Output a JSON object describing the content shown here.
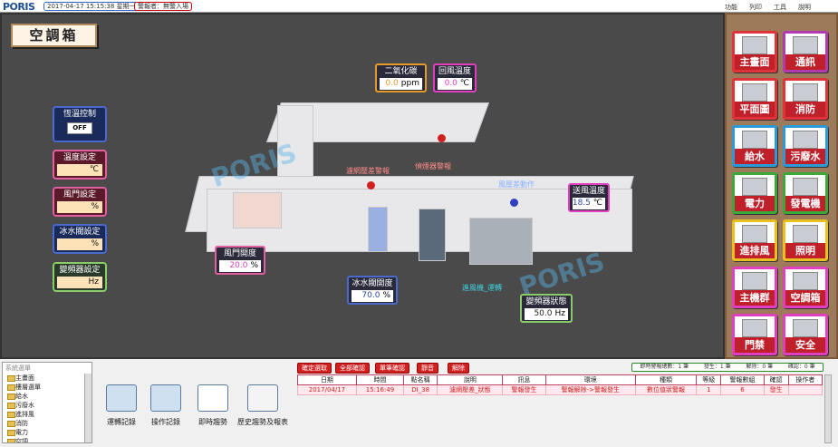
{
  "topbar": {
    "logo": "PORIS",
    "datetime": "2017-04-17 15:15:38 星期一",
    "alarm": "警報者：無警入場",
    "menu": [
      "功能",
      "列印",
      "工具",
      "說明"
    ]
  },
  "page_title": "空調箱",
  "left_controls": [
    {
      "label": "恆溫控制",
      "toggle": "OFF"
    },
    {
      "label": "溫度設定",
      "unit": "℃"
    },
    {
      "label": "風門設定",
      "unit": "%"
    },
    {
      "label": "冰水閥設定",
      "unit": "%"
    },
    {
      "label": "變頻器設定",
      "unit": "Hz"
    }
  ],
  "readouts": {
    "co2": {
      "label": "二氧化碳",
      "value": "0.0",
      "unit": "ppm"
    },
    "return_temp": {
      "label": "回風溫度",
      "value": "0.0",
      "unit": "℃"
    },
    "supply_temp": {
      "label": "送風溫度",
      "value": "18.5",
      "unit": "℃"
    },
    "damper_open": {
      "label": "風門開度",
      "value": "20.0",
      "unit": "%"
    },
    "chw_valve": {
      "label": "冰水閥開度",
      "value": "70.0",
      "unit": "%"
    },
    "vfd_status": {
      "label": "變頻器狀態",
      "value": "50.0",
      "unit": "Hz"
    }
  },
  "diagram_labels": {
    "filter_alarm": "濾網壓差警報",
    "smoke_alarm": "偵煙器警報",
    "fan_pressure": "風壓差動作",
    "fan_status": "進風機_運轉"
  },
  "watermarks": [
    "PORIS",
    "PORIS"
  ],
  "nav": [
    {
      "label": "主畫面",
      "color": "#e0343a"
    },
    {
      "label": "通訊",
      "color": "#b03ab0"
    },
    {
      "label": "平面圖",
      "color": "#e0343a"
    },
    {
      "label": "消防",
      "color": "#e0343a"
    },
    {
      "label": "給水",
      "color": "#2a9ad8"
    },
    {
      "label": "污廢水",
      "color": "#2a9ad8"
    },
    {
      "label": "電力",
      "color": "#3aa83a"
    },
    {
      "label": "發電機",
      "color": "#3aa83a"
    },
    {
      "label": "進排風",
      "color": "#e8c020"
    },
    {
      "label": "照明",
      "color": "#e8c020"
    },
    {
      "label": "主機群",
      "color": "#e040c0"
    },
    {
      "label": "空調箱",
      "color": "#e040c0"
    },
    {
      "label": "門禁",
      "color": "#e040c0"
    },
    {
      "label": "安全",
      "color": "#e040c0"
    }
  ],
  "tree": {
    "header": "系統選單",
    "items": [
      "主畫面",
      "樓層選單",
      "給水",
      "污廢水",
      "進排風",
      "消防",
      "電力",
      "空調"
    ]
  },
  "tools": [
    "運轉記錄",
    "操作記錄",
    "即時趨勢",
    "歷史趨勢及報表"
  ],
  "alarm_buttons": [
    "確定選取",
    "全部確認",
    "單筆確認",
    "靜音",
    "解除"
  ],
  "alarm_stats": [
    "即時警報總數：1 筆",
    "發生：1 筆",
    "解除：0 筆",
    "確認：0 筆"
  ],
  "alarm_table": {
    "headers": [
      "日期",
      "時間",
      "點名稱",
      "說明",
      "訊息",
      "環境",
      "種類",
      "等級",
      "警報數組",
      "確認",
      "操作者"
    ],
    "rows": [
      [
        "2017/04/17",
        "15:16:49",
        "DI_38",
        "濾網壓差_狀態",
        "警報發生",
        "警報解除->警報發生",
        "數位值狀警報",
        "1",
        "6",
        "發生",
        ""
      ]
    ]
  }
}
